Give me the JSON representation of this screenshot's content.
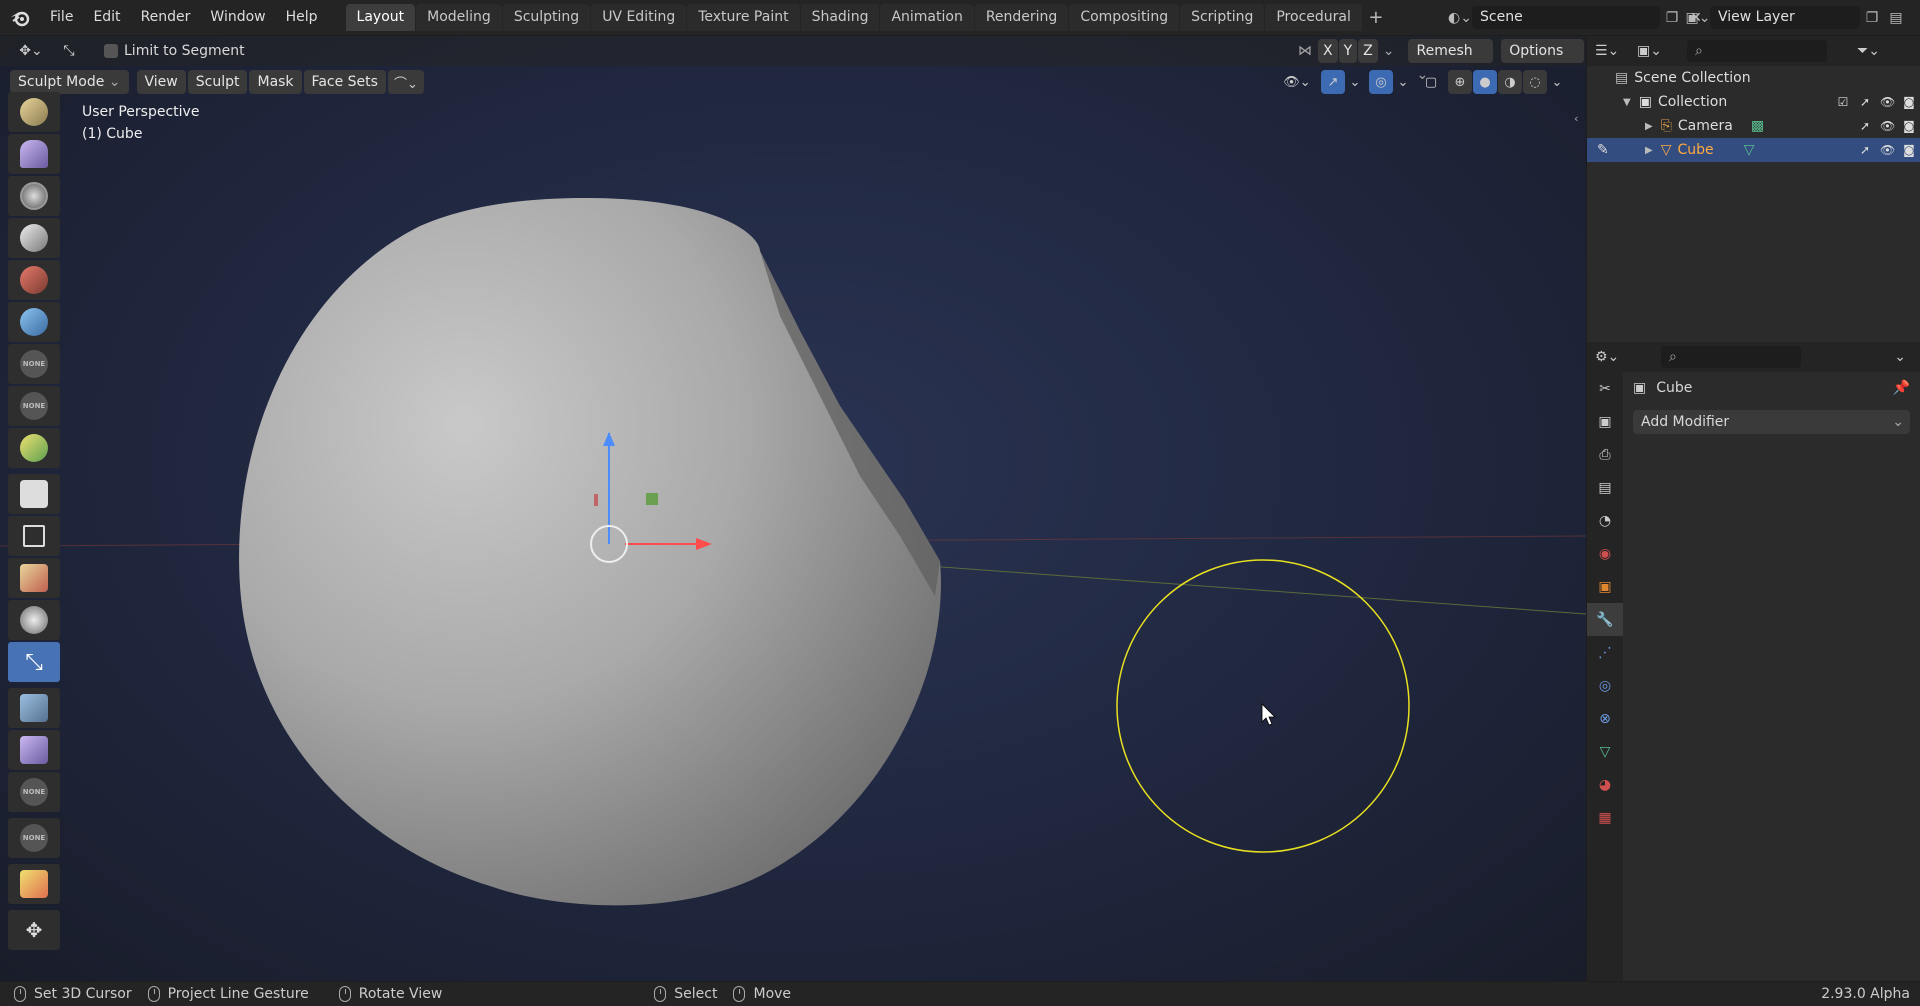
{
  "menu": [
    "File",
    "Edit",
    "Render",
    "Window",
    "Help"
  ],
  "workspace_tabs": [
    "Layout",
    "Modeling",
    "Sculpting",
    "UV Editing",
    "Texture Paint",
    "Shading",
    "Animation",
    "Rendering",
    "Compositing",
    "Scripting",
    "Procedural"
  ],
  "active_tab": "Layout",
  "scene_field": "Scene",
  "view_layer_field": "View Layer",
  "tool_header": {
    "limit_to_segment": "Limit to Segment",
    "axis_x": "X",
    "axis_y": "Y",
    "axis_z": "Z",
    "remesh": "Remesh",
    "options": "Options"
  },
  "viewport_header": {
    "mode": "Sculpt Mode",
    "view": "View",
    "sculpt": "Sculpt",
    "mask": "Mask",
    "face_sets": "Face Sets"
  },
  "viewport_overlay": {
    "perspective": "User Perspective",
    "object": "(1) Cube"
  },
  "toolbar_none_label": "NONE",
  "outliner": {
    "scene_collection": "Scene Collection",
    "collection": "Collection",
    "camera": "Camera",
    "cube": "Cube"
  },
  "properties": {
    "object_name": "Cube",
    "add_modifier": "Add Modifier"
  },
  "statusbar": {
    "set_cursor": "Set 3D Cursor",
    "project_line": "Project Line Gesture",
    "rotate_view": "Rotate View",
    "select": "Select",
    "move": "Move",
    "version": "2.93.0 Alpha"
  },
  "colors": {
    "accent_blue": "#4772b3",
    "selected_row": "#334d80",
    "brush_circle": "#e8e020",
    "active_object_text": "#ffaa40"
  }
}
